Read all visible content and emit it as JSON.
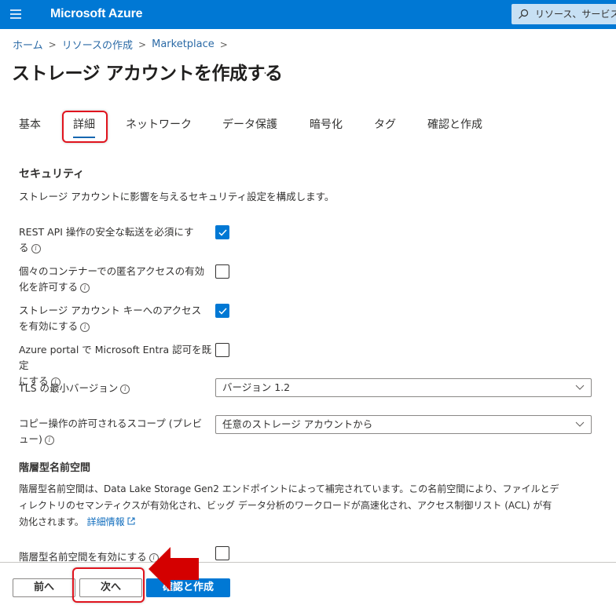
{
  "topbar": {
    "brand": "Microsoft Azure",
    "menu_icon": "hamburger-menu-icon",
    "search_placeholder": "リソース、サービス、ドキュメントの検索",
    "search_icon": "search-icon",
    "color": "#0078d4"
  },
  "breadcrumb": {
    "items": [
      "ホーム",
      "リソースの作成",
      "Marketplace"
    ],
    "separator": ">"
  },
  "page": {
    "title": "ストレージ アカウントを作成する",
    "more_label": "…"
  },
  "tabs": [
    {
      "label": "基本",
      "active": false
    },
    {
      "label": "詳細",
      "active": true
    },
    {
      "label": "ネットワーク",
      "active": false
    },
    {
      "label": "データ保護",
      "active": false
    },
    {
      "label": "暗号化",
      "active": false
    },
    {
      "label": "タグ",
      "active": false
    },
    {
      "label": "確認と作成",
      "active": false
    }
  ],
  "security": {
    "heading": "セキュリティ",
    "description": "ストレージ アカウントに影響を与えるセキュリティ設定を構成します。",
    "checkboxes": [
      {
        "label_line1": "REST API 操作の安全な転送を必須にす",
        "label_line2": "る",
        "checked": true
      },
      {
        "label_line1": "個々のコンテナーでの匿名アクセスの有効",
        "label_line2": "化を許可する",
        "checked": false
      },
      {
        "label_line1": "ストレージ アカウント キーへのアクセス",
        "label_line2": "を有効にする",
        "checked": true
      },
      {
        "label_line1": "Azure portal で Microsoft Entra 認可を既定",
        "label_line2": "にする",
        "checked": false
      }
    ],
    "tls": {
      "label": "TLS の最小バージョン",
      "value": "バージョン 1.2"
    },
    "copy_scope": {
      "label_line1": "コピー操作の許可されるスコープ (プレビ",
      "label_line2": "ュー)",
      "value": "任意のストレージ アカウントから"
    }
  },
  "hns": {
    "heading": "階層型名前空間",
    "description_line1": "階層型名前空間は、Data Lake Storage Gen2 エンドポイントによって補完されています。この名前空間により、ファイルとデ",
    "description_line2": "ィレクトリのセマンティクスが有効化され、ビッグ データ分析のワークロードが高速化され、アクセス制御リスト (ACL) が有",
    "description_line3": "効化されます。",
    "learn_more": "詳細情報",
    "checkbox_label": "階層型名前空間を有効にする",
    "checked": false
  },
  "footer": {
    "prev_label": "前へ",
    "next_label": "次へ",
    "review_label": "確認と作成"
  },
  "annotations": {
    "highlight_color": "#e0141e",
    "arrow_color": "#d40000"
  }
}
